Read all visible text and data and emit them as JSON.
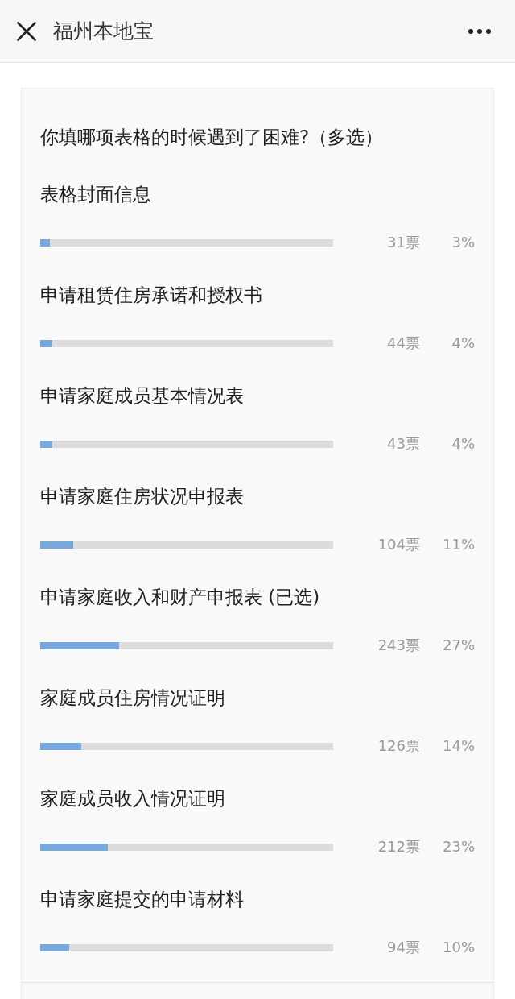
{
  "header": {
    "title": "福州本地宝"
  },
  "poll": {
    "question": "你填哪项表格的时候遇到了困难?（多选）",
    "options": [
      {
        "label": "表格封面信息",
        "votes": "31票",
        "percent": "3%",
        "level": 0.033
      },
      {
        "label": "申请租赁住房承诺和授权书",
        "votes": "44票",
        "percent": "4%",
        "level": 0.042
      },
      {
        "label": "申请家庭成员基本情况表",
        "votes": "43票",
        "percent": "4%",
        "level": 0.042
      },
      {
        "label": "申请家庭住房状况申报表",
        "votes": "104票",
        "percent": "11%",
        "level": 0.113
      },
      {
        "label": "申请家庭收入和财产申报表 (已选)",
        "votes": "243票",
        "percent": "27%",
        "level": 0.27
      },
      {
        "label": "家庭成员住房情况证明",
        "votes": "126票",
        "percent": "14%",
        "level": 0.14
      },
      {
        "label": "家庭成员收入情况证明",
        "votes": "212票",
        "percent": "23%",
        "level": 0.23
      },
      {
        "label": "申请家庭提交的申请材料",
        "votes": "94票",
        "percent": "10%",
        "level": 0.1
      }
    ]
  }
}
